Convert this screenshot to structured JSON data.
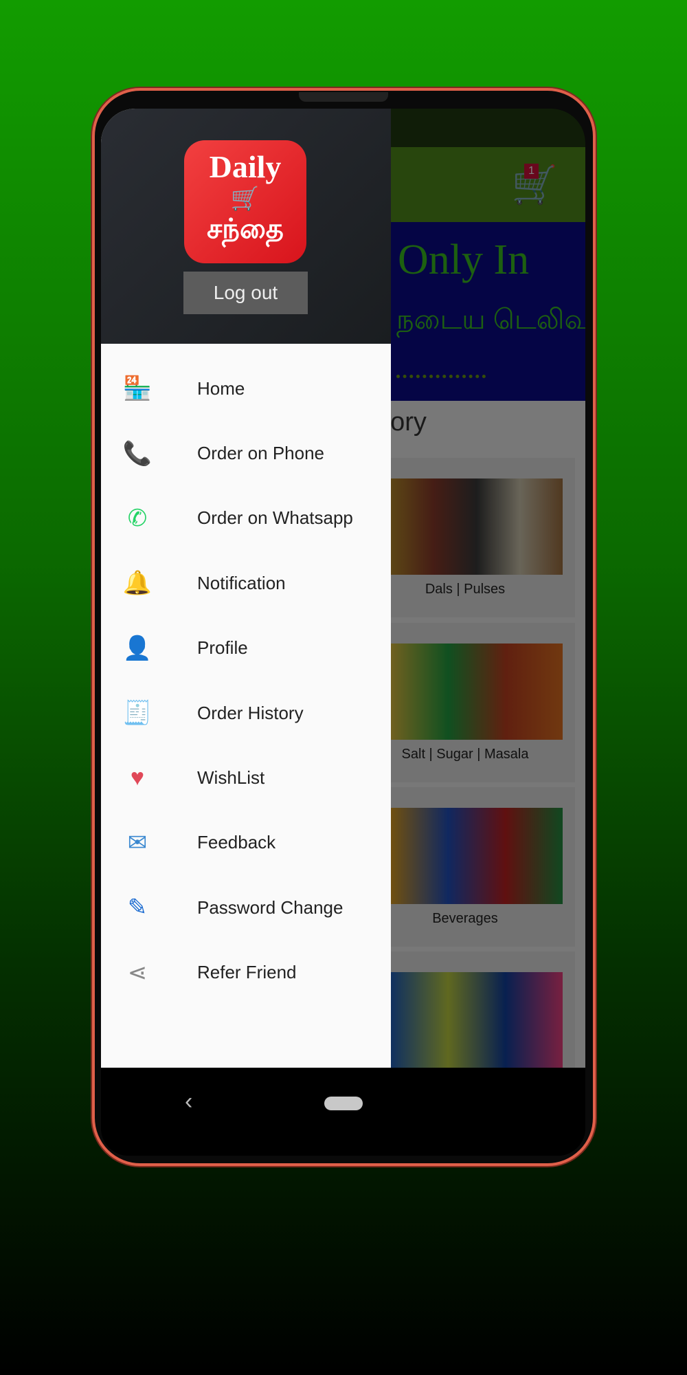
{
  "app": {
    "logo_text": [
      "Daily",
      "🛒",
      "சந்தை"
    ],
    "cart_badge": "1"
  },
  "banner": {
    "headline": "Only In",
    "tamil_text": "நடைய டெலிவரி"
  },
  "category": {
    "title": "gory",
    "cards": [
      {
        "label": "Dals | Pulses"
      },
      {
        "label": "Salt | Sugar | Masala"
      },
      {
        "label": "Beverages"
      },
      {
        "label": ""
      }
    ]
  },
  "drawer": {
    "logout_label": "Log out",
    "items": [
      {
        "label": "Home",
        "icon": "store-icon",
        "glyph": "🏪",
        "color": "#f0a020"
      },
      {
        "label": "Order on Phone",
        "icon": "phone-icon",
        "glyph": "📞",
        "color": "#e88a10"
      },
      {
        "label": "Order on Whatsapp",
        "icon": "whatsapp-icon",
        "glyph": "✆",
        "color": "#25d366"
      },
      {
        "label": "Notification",
        "icon": "bell-icon",
        "glyph": "🔔",
        "color": "#f0a020"
      },
      {
        "label": "Profile",
        "icon": "user-icon",
        "glyph": "👤",
        "color": "#4aa8e0"
      },
      {
        "label": "Order History",
        "icon": "receipt-icon",
        "glyph": "🧾",
        "color": "#6a7ad8"
      },
      {
        "label": "WishList",
        "icon": "heart-icon",
        "glyph": "♥",
        "color": "#e04858"
      },
      {
        "label": "Feedback",
        "icon": "feedback-mail-icon",
        "glyph": "✉",
        "color": "#3a88d0"
      },
      {
        "label": "Password Change",
        "icon": "pencil-icon",
        "glyph": "✎",
        "color": "#1a6ad0"
      },
      {
        "label": "Refer Friend",
        "icon": "share-icon",
        "glyph": "⋖",
        "color": "#888888"
      }
    ]
  },
  "nav": {
    "back_glyph": "‹"
  }
}
